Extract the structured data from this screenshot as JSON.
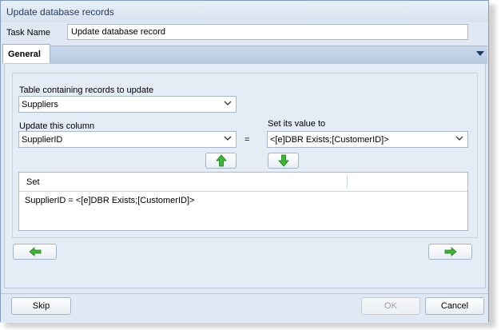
{
  "window": {
    "title": "Update database records"
  },
  "task_name": {
    "label": "Task Name",
    "value": "Update database record"
  },
  "tabs": [
    {
      "label": "General"
    }
  ],
  "table_section": {
    "label": "Table containing records to update",
    "selected": "Suppliers"
  },
  "column_section": {
    "label": "Update this column",
    "selected": "SupplierID"
  },
  "equals_sign": "=",
  "value_section": {
    "label": "Set its value to",
    "selected": "<[e]DBR Exists;[CustomerID]>"
  },
  "set_grid": {
    "header": "Set",
    "rows": [
      "SupplierID = <[e]DBR Exists;[CustomerID]>"
    ]
  },
  "buttons": {
    "skip": "Skip",
    "ok": "OK",
    "cancel": "Cancel"
  },
  "colors": {
    "arrow_green": "#3cb832"
  },
  "icons": {
    "move_up": "green-arrow-up-icon",
    "move_down": "green-arrow-down-icon",
    "back": "green-arrow-left-icon",
    "next": "green-arrow-right-icon"
  }
}
